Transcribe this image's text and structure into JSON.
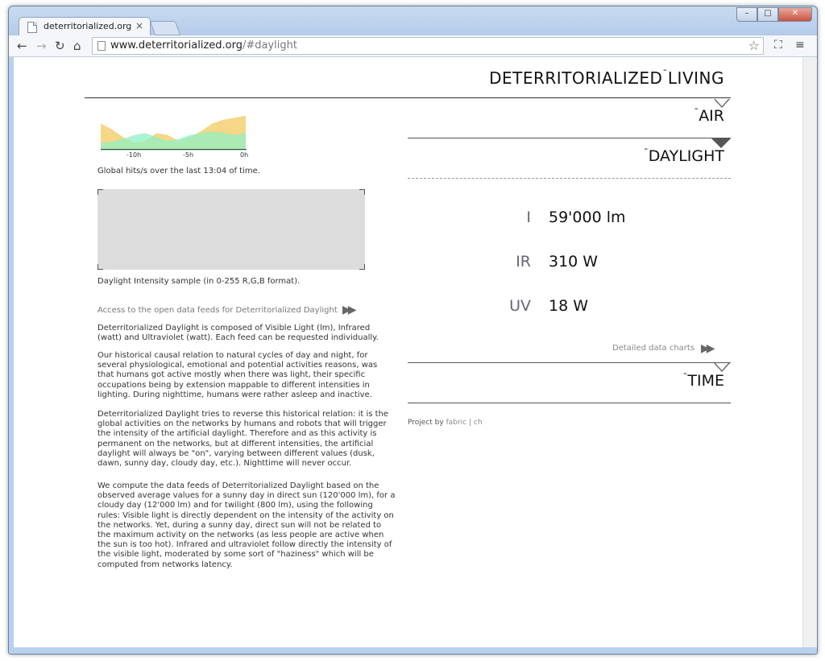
{
  "browser": {
    "tab_title": "deterritorialized.org",
    "tab_close": "×",
    "url_host": "www.deterritorialized.org",
    "url_path": "/#daylight",
    "back": "←",
    "forward": "→",
    "reload": "↻",
    "home": "⌂",
    "star": "☆",
    "cast": "⛶",
    "menu": "≡",
    "minimize": "–",
    "maximize": "□",
    "close": "✕"
  },
  "site": {
    "title_left": "DETERRITORIALIZED",
    "title_sep": "¯",
    "title_right": "LIVING"
  },
  "sections": {
    "air": "AIR",
    "daylight": "DAYLIGHT",
    "time": "TIME",
    "sep": "¯"
  },
  "metrics": [
    {
      "label": "I",
      "value": "59'000 lm"
    },
    {
      "label": "IR",
      "value": "310 W"
    },
    {
      "label": "UV",
      "value": "18 W"
    }
  ],
  "detailed_link": "Detailed data charts",
  "go_arrow": "▶▶",
  "hits_chart": {
    "ticks": [
      "-10h",
      "-5h",
      "0h"
    ],
    "caption": "Global hits/s over the last 13:04 of time.",
    "colors": {
      "series_a": "#f4d37a",
      "series_b": "#8ff0c4"
    }
  },
  "chart_data": {
    "type": "area",
    "x": [
      -13,
      -12,
      -11,
      -10,
      -9,
      -8,
      -7,
      -6,
      -5,
      -4,
      -3,
      -2,
      -1,
      0
    ],
    "series": [
      {
        "values": [
          28,
          22,
          14,
          8,
          10,
          18,
          16,
          10,
          14,
          20,
          28,
          32,
          34,
          36
        ]
      },
      {
        "values": [
          8,
          9,
          12,
          16,
          18,
          14,
          10,
          12,
          16,
          18,
          20,
          18,
          16,
          18
        ]
      }
    ],
    "xticks": [
      "-10h",
      "-5h",
      "0h"
    ],
    "title": "",
    "ylim": [
      0,
      40
    ]
  },
  "sample": {
    "caption": "Daylight Intensity sample (in 0-255 R,G,B format)."
  },
  "feeds_link": "Access to the open data feeds for Deterritorialized Daylight",
  "paragraphs": [
    "Deterritorialized Daylight is composed of Visible Light (lm), Infrared (watt) and Ultraviolet (watt). Each feed can be requested individually.",
    "Our historical causal relation to natural cycles of day and night, for several physiological, emotional and potential activities reasons, was that humans got active mostly when there was light, their specific occupations being by extension mappable to different intensities in lighting. During nighttime, humans were rather asleep and inactive.",
    "Deterritorialized Daylight tries to reverse this historical relation: it is the global activities on the networks by humans and robots that will trigger the intensity of the artificial daylight. Therefore and as this activity is permanent on the networks, but at different intensities, the artificial daylight will always be \"on\", varying between different values (dusk, dawn, sunny day, cloudy day, etc.). Nighttime will never occur.",
    "We compute the data feeds of Deterritorialized Daylight based on the observed average values for a sunny day in direct sun (120'000 lm), for a cloudy day (12'000 lm) and for twilight (800 lm), using the following rules: Visible light is directly dependent on the intensity of the activity on the networks. Yet, during a sunny day, direct sun will not be related to the maximum activity on the networks (as less people are active when the sun is too hot). Infrared and ultraviolet follow directly the intensity of the visible light, moderated by some sort of \"haziness\" which will be computed from networks latency."
  ],
  "credit": {
    "prefix": "Project by",
    "who": "fabric | ch"
  }
}
